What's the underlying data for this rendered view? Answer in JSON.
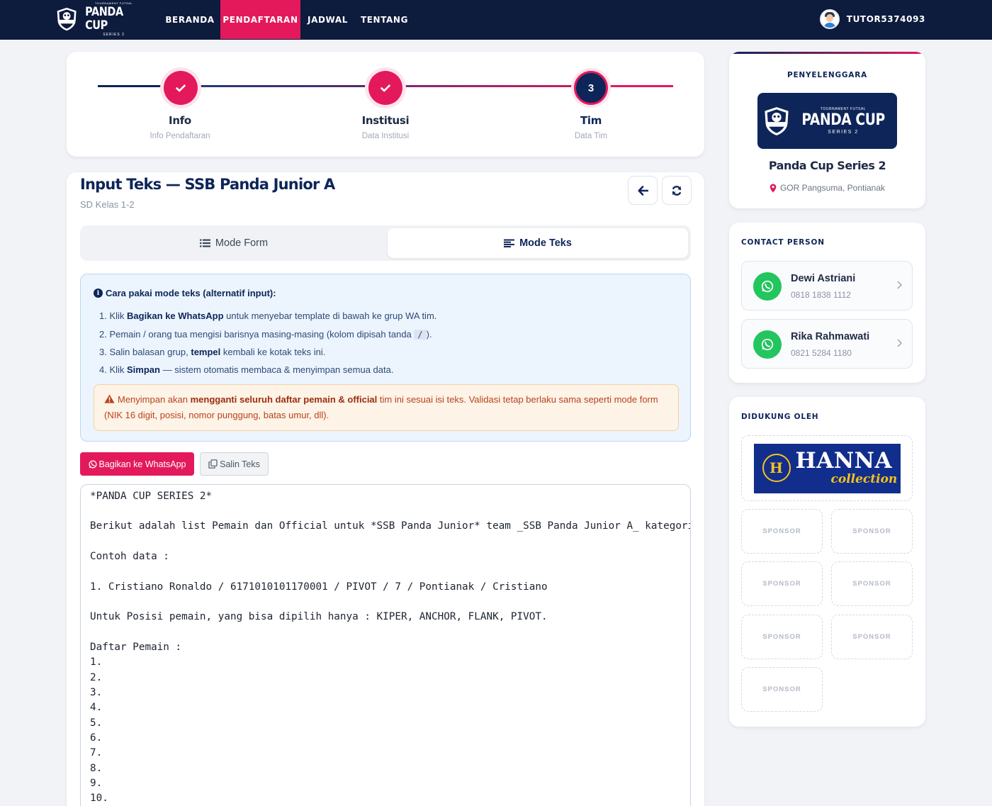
{
  "brand": {
    "logo_top_text": "TOURNAMENT FUTSAL",
    "logo_main_text": "PANDA CUP",
    "logo_sub_text": "SERIES 2",
    "shield_text": "PANDA CUP"
  },
  "nav": {
    "items": [
      {
        "label": "BERANDA",
        "active": false
      },
      {
        "label": "PENDAFTARAN",
        "active": true
      },
      {
        "label": "JADWAL",
        "active": false
      },
      {
        "label": "TENTANG",
        "active": false
      }
    ],
    "username": "TUTOR5374093"
  },
  "stepper": {
    "steps": [
      {
        "title": "Info",
        "subtitle": "Info Pendaftaran",
        "state": "done"
      },
      {
        "title": "Institusi",
        "subtitle": "Data Institusi",
        "state": "done"
      },
      {
        "title": "Tim",
        "subtitle": "Data Tim",
        "state": "current",
        "number": "3"
      }
    ]
  },
  "form": {
    "title": "Input Teks — SSB Panda Junior A",
    "subtitle": "SD Kelas 1-2",
    "tabs": {
      "form_label": "Mode Form",
      "text_label": "Mode Teks",
      "active": "text"
    },
    "info": {
      "heading": "Cara pakai mode teks (alternatif input):",
      "step1": {
        "pre": "1. Klik ",
        "bold": "Bagikan ke WhatsApp",
        "post": " untuk menyebar template di bawah ke grup WA tim."
      },
      "step2": {
        "pre": "2. Pemain / orang tua mengisi barisnya masing-masing (kolom dipisah tanda ",
        "code": "/",
        "post": ")."
      },
      "step3": {
        "pre": "3. Salin balasan grup, ",
        "bold": "tempel",
        "post": " kembali ke kotak teks ini."
      },
      "step4": {
        "pre": "4. Klik ",
        "bold": "Simpan",
        "post": " — sistem otomatis membaca & menyimpan semua data."
      }
    },
    "warning": {
      "pre": "Menyimpan akan ",
      "bold": "mengganti seluruh daftar pemain & official",
      "post": " tim ini sesuai isi teks. Validasi tetap berlaku sama seperti mode form (NIK 16 digit, posisi, nomor punggung, batas umur, dll)."
    },
    "share_button": "Bagikan ke WhatsApp",
    "copy_button": "Salin Teks",
    "textarea_lines": [
      "*PANDA CUP SERIES 2*",
      "",
      "Berikut adalah list Pemain dan Official untuk *SSB Panda Junior* team _SSB Panda Junior A_ kategori",
      "",
      "Contoh data :",
      "",
      "1. Cristiano Ronaldo / 6171010101170001 / PIVOT / 7 / Pontianak / Cristiano",
      "",
      "Untuk Posisi pemain, yang bisa dipilih hanya : KIPER, ANCHOR, FLANK, PIVOT.",
      "",
      "Daftar Pemain :",
      "1.",
      "2.",
      "3.",
      "4.",
      "5.",
      "6.",
      "7.",
      "8.",
      "9.",
      "10."
    ]
  },
  "sidebar": {
    "organizer": {
      "label": "PENYELENGGARA",
      "name": "Panda Cup Series 2",
      "location": "GOR Pangsuma, Pontianak"
    },
    "contact": {
      "label": "CONTACT PERSON",
      "people": [
        {
          "name": "Dewi Astriani",
          "phone": "0818 1838 1112"
        },
        {
          "name": "Rika Rahmawati",
          "phone": "0821 5284 1180"
        }
      ]
    },
    "support": {
      "label": "DIDUKUNG OLEH",
      "main_sponsor_word": "HANNA",
      "main_sponsor_sub": "collection",
      "main_sponsor_badge": "H",
      "slots": [
        "SPONSOR",
        "SPONSOR",
        "SPONSOR",
        "SPONSOR",
        "SPONSOR",
        "SPONSOR",
        "SPONSOR"
      ]
    }
  },
  "colors": {
    "navy": "#0d1b3d",
    "brand_pink": "#e3195c",
    "title_navy": "#0d2558",
    "whatsapp_green": "#22c55e"
  }
}
